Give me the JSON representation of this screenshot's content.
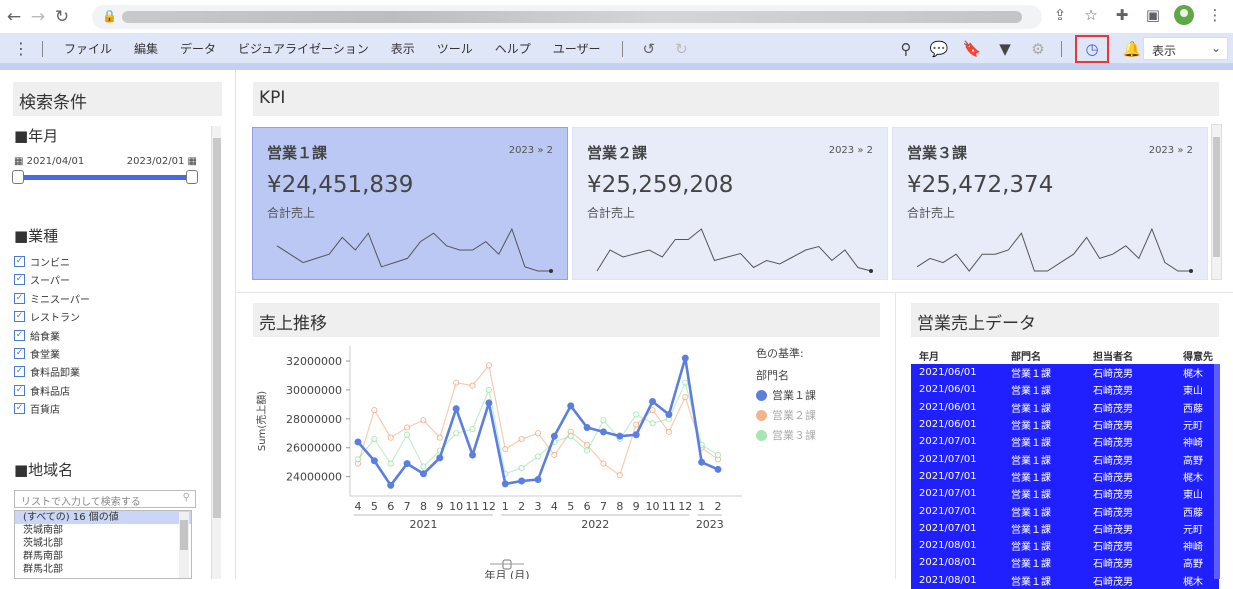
{
  "menubar": {
    "items": [
      "ファイル",
      "編集",
      "データ",
      "ビジュアライゼーション",
      "表示",
      "ツール",
      "ヘルプ",
      "ユーザー"
    ],
    "display_select": "表示"
  },
  "left": {
    "title": "検索条件",
    "year_month": {
      "label": "■年月",
      "start": "2021/04/01",
      "end": "2023/02/01"
    },
    "industry": {
      "label": "■業種",
      "items": [
        "コンビニ",
        "スーパー",
        "ミニスーパー",
        "レストラン",
        "給食業",
        "食堂業",
        "食料品卸業",
        "食料品店",
        "百貨店"
      ]
    },
    "region": {
      "label": "■地域名",
      "search_placeholder": "リストで入力して検索する",
      "items": [
        "(すべての) 16 個の値",
        "茨城南部",
        "茨城北部",
        "群馬南部",
        "群馬北部"
      ]
    }
  },
  "kpi": {
    "title": "KPI",
    "cards": [
      {
        "name": "営業１課",
        "page": "2023 » 2",
        "value": "¥24,451,839",
        "sub": "合計売上",
        "spark": [
          26,
          24,
          22,
          23,
          24,
          28,
          25,
          29,
          21,
          22,
          23,
          27,
          29,
          26,
          25,
          25,
          27,
          24,
          30,
          21,
          20,
          20
        ]
      },
      {
        "name": "営業２課",
        "page": "2023 » 2",
        "value": "¥25,259,208",
        "sub": "合計売上",
        "spark": [
          21,
          27,
          25,
          26,
          27,
          25,
          30,
          30,
          33,
          24,
          25,
          26,
          22,
          24,
          23,
          25,
          27,
          28,
          24,
          27,
          22,
          21
        ]
      },
      {
        "name": "営業３課",
        "page": "2023 » 2",
        "value": "¥25,472,374",
        "sub": "合計売上",
        "spark": [
          23,
          25,
          24,
          26,
          22,
          26,
          26,
          27,
          31,
          22,
          22,
          24,
          26,
          30,
          25,
          26,
          28,
          25,
          32,
          24,
          22,
          22
        ]
      }
    ]
  },
  "chart": {
    "title": "売上推移",
    "legend_title": "色の基準:",
    "legend_sub": "部門名",
    "x_title": "年月 (月)"
  },
  "chart_data": {
    "type": "line",
    "x": [
      "4",
      "5",
      "6",
      "7",
      "8",
      "9",
      "10",
      "11",
      "12",
      "1",
      "2",
      "3",
      "4",
      "5",
      "6",
      "7",
      "8",
      "9",
      "10",
      "11",
      "12",
      "1",
      "2"
    ],
    "year_groups": [
      {
        "label": "2021",
        "from": 0,
        "to": 8
      },
      {
        "label": "2022",
        "from": 9,
        "to": 20
      },
      {
        "label": "2023",
        "from": 21,
        "to": 22
      }
    ],
    "ylabel": "Sum(売上額)",
    "ylim": [
      22800000,
      32900000
    ],
    "yticks": [
      24000000,
      26000000,
      28000000,
      30000000,
      32000000
    ],
    "series": [
      {
        "name": "営業１課",
        "color": "#5b7fe0",
        "values": [
          26400000,
          25100000,
          23400000,
          24900000,
          24200000,
          25300000,
          28700000,
          25500000,
          29100000,
          23500000,
          23700000,
          23800000,
          26800000,
          28900000,
          27400000,
          27100000,
          26800000,
          26900000,
          29200000,
          28300000,
          32200000,
          25000000,
          24500000
        ]
      },
      {
        "name": "営業２課",
        "color": "#f0a070",
        "values": [
          24900000,
          28600000,
          26700000,
          27400000,
          27900000,
          26700000,
          30500000,
          30300000,
          31700000,
          25900000,
          26600000,
          27000000,
          25500000,
          27100000,
          26200000,
          24900000,
          24100000,
          27600000,
          28600000,
          27100000,
          29500000,
          26000000,
          25200000
        ]
      },
      {
        "name": "営業３課",
        "color": "#8ee0a0",
        "values": [
          25200000,
          26600000,
          24900000,
          26900000,
          24700000,
          25800000,
          27000000,
          27300000,
          30000000,
          24200000,
          24600000,
          25400000,
          26400000,
          26800000,
          25800000,
          27900000,
          26600000,
          28300000,
          27700000,
          28000000,
          30500000,
          26200000,
          25500000
        ]
      }
    ]
  },
  "table": {
    "title": "営業売上データ",
    "columns": [
      "年月",
      "部門名",
      "担当者名",
      "得意先"
    ],
    "rows": [
      [
        "2021/06/01",
        "営業１課",
        "石崎茂男",
        "梶木"
      ],
      [
        "2021/06/01",
        "営業１課",
        "石崎茂男",
        "東山"
      ],
      [
        "2021/06/01",
        "営業１課",
        "石崎茂男",
        "西藤"
      ],
      [
        "2021/06/01",
        "営業１課",
        "石崎茂男",
        "元町"
      ],
      [
        "2021/07/01",
        "営業１課",
        "石崎茂男",
        "神崎"
      ],
      [
        "2021/07/01",
        "営業１課",
        "石崎茂男",
        "高野"
      ],
      [
        "2021/07/01",
        "営業１課",
        "石崎茂男",
        "梶木"
      ],
      [
        "2021/07/01",
        "営業１課",
        "石崎茂男",
        "東山"
      ],
      [
        "2021/07/01",
        "営業１課",
        "石崎茂男",
        "西藤"
      ],
      [
        "2021/07/01",
        "営業１課",
        "石崎茂男",
        "元町"
      ],
      [
        "2021/08/01",
        "営業１課",
        "石崎茂男",
        "神崎"
      ],
      [
        "2021/08/01",
        "営業１課",
        "石崎茂男",
        "高野"
      ],
      [
        "2021/08/01",
        "営業１課",
        "石崎茂男",
        "梶木"
      ]
    ]
  }
}
